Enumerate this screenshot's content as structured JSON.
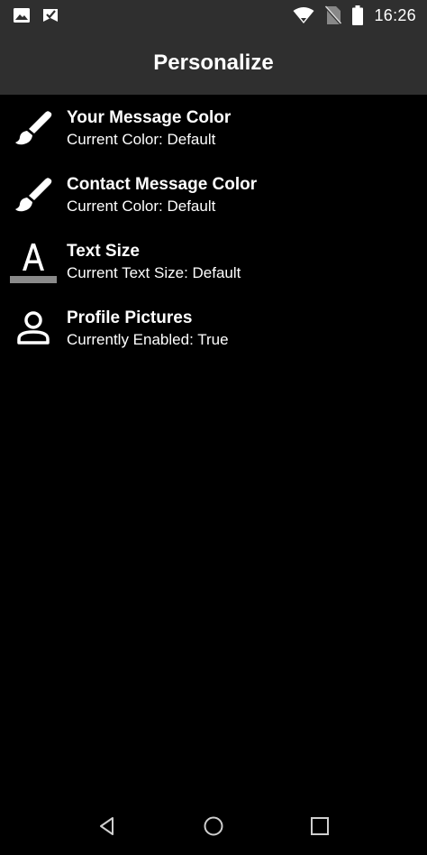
{
  "status_bar": {
    "time": "16:26",
    "icons_left": [
      "image-icon",
      "app-notification-icon"
    ],
    "icons_right": [
      "wifi-icon",
      "no-sim-icon",
      "battery-icon"
    ]
  },
  "app_bar": {
    "title": "Personalize"
  },
  "settings": [
    {
      "icon": "paint-brush-icon",
      "title": "Your Message Color",
      "subtitle": "Current Color: Default"
    },
    {
      "icon": "paint-brush-icon",
      "title": "Contact Message Color",
      "subtitle": "Current Color: Default"
    },
    {
      "icon": "text-size-icon",
      "title": "Text Size",
      "subtitle": "Current Text Size: Default"
    },
    {
      "icon": "person-icon",
      "title": "Profile Pictures",
      "subtitle": "Currently Enabled: True"
    }
  ],
  "nav_bar": {
    "buttons": [
      "back-icon",
      "home-icon",
      "recents-icon"
    ]
  },
  "colors": {
    "bar_bg": "#2f2f2f",
    "background": "#000000",
    "text": "#ffffff"
  }
}
